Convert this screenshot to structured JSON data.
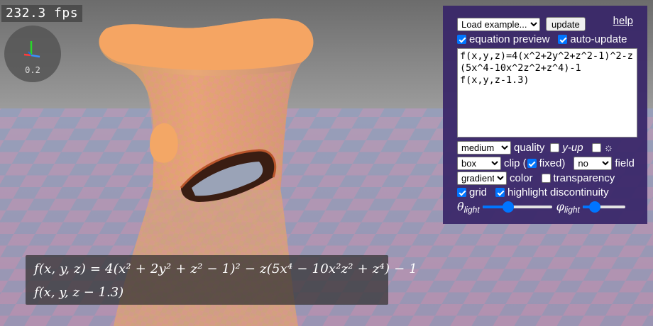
{
  "hud": {
    "fps": "232.3 fps",
    "gizmo_scale": "0.2"
  },
  "panel": {
    "example_select": "Load example...",
    "update_label": "update",
    "help_label": "help",
    "equation_preview_label": "equation preview",
    "equation_preview_checked": true,
    "auto_update_label": "auto-update",
    "auto_update_checked": true,
    "equation_text": "f(x,y,z)=4(x^2+2y^2+z^2-1)^2-z(5x^4-10x^2z^2+z^4)-1\nf(x,y,z-1.3)",
    "quality_select": "medium",
    "quality_label": "quality",
    "y_up_label": "y-up",
    "y_up_checked": false,
    "light_theme_checked": false,
    "light_theme_icon": "☼",
    "clip_select": "box",
    "clip_label": "clip (",
    "fixed_label": "fixed)",
    "fixed_checked": true,
    "field_select": "no",
    "field_label": "field",
    "color_select": "gradient",
    "color_label": "color",
    "transparency_label": "transparency",
    "transparency_checked": false,
    "grid_label": "grid",
    "grid_checked": true,
    "highlight_label": "highlight discontinuity",
    "highlight_checked": true,
    "theta_symbol": "θ",
    "theta_sub": "light",
    "theta_value": 0.35,
    "phi_symbol": "φ",
    "phi_sub": "light",
    "phi_value": 0.2
  },
  "equation_preview": {
    "line1_prefix": "f(x, y, z) = 4(x",
    "line1_rest": "f(x,y,z)=4(x^2+2y^2+z^2-1)^2-z(5x^4-10x^2z^2+z^4)-1",
    "line2": "f(x, y, z − 1.3)"
  },
  "colors": {
    "panel_bg": "#382668",
    "checkbox_accent": "#0075ff",
    "surface_orange": "#f6a35e",
    "floor_pink": "#b98fb3",
    "floor_blue": "#8a9cbb",
    "sky": "#8a8a8a"
  }
}
